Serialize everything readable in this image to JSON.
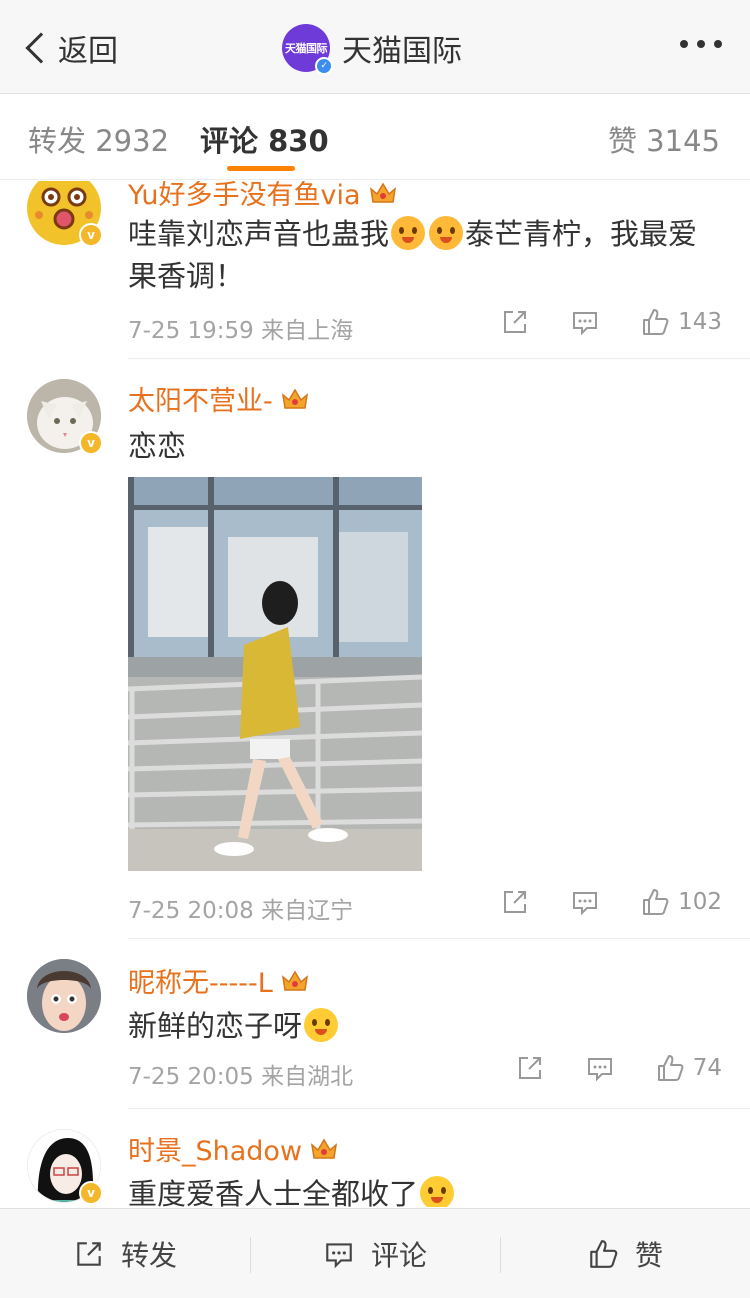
{
  "nav": {
    "back_label": "返回",
    "brand_logo_text": "天猫国际",
    "title": "天猫国际"
  },
  "tabs": {
    "repost": "转发 2932",
    "comments": "评论 830",
    "likes": "赞 3145"
  },
  "comments": [
    {
      "username": "Yu好多手没有鱼via",
      "text_a": "哇靠刘恋声音也蛊我",
      "text_b": "泰芒青柠，我最爱果香调！",
      "date": "7-25 19:59",
      "location": "来自上海",
      "likes": "143"
    },
    {
      "username": "太阳不营业-",
      "text_a": "恋恋",
      "date": "7-25 20:08",
      "location": "来自辽宁",
      "likes": "102"
    },
    {
      "username": "昵称无-----L",
      "text_a": "新鲜的恋子呀",
      "date": "7-25 20:05",
      "location": "来自湖北",
      "likes": "74"
    },
    {
      "username": "时景_Shadow",
      "text_a": "重度爱香人士全都收了"
    }
  ],
  "bottom_bar": {
    "repost": "转发",
    "comment": "评论",
    "like": "赞"
  },
  "colors": {
    "username": "#e8711d",
    "tab_underline": "#ff8200",
    "meta": "#a4a4a4"
  },
  "icons": [
    "chevron-left-icon",
    "more-icon",
    "share-icon",
    "comment-icon",
    "thumbs-up-icon",
    "crown-icon",
    "verified-badge-icon"
  ]
}
